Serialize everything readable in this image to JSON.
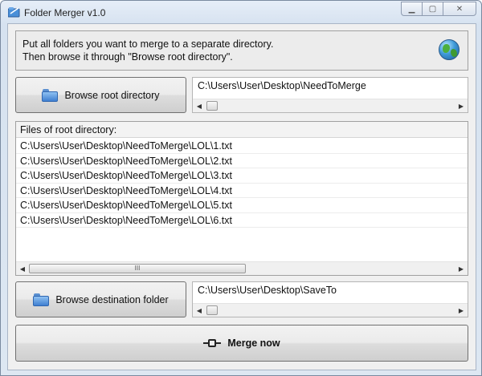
{
  "window": {
    "title": "Folder Merger v1.0",
    "controls": {
      "minimize": "▁",
      "maximize": "▢",
      "close": "✕"
    }
  },
  "info": {
    "line1": "Put all folders you want to merge to a separate directory.",
    "line2": "Then browse it through \"Browse root directory\".",
    "icon": "globe-icon"
  },
  "root": {
    "button_label": "Browse root directory",
    "path": "C:\\Users\\User\\Desktop\\NeedToMerge",
    "icon": "folder-icon"
  },
  "files": {
    "header": "Files of root directory:",
    "items": [
      "C:\\Users\\User\\Desktop\\NeedToMerge\\LOL\\1.txt",
      "C:\\Users\\User\\Desktop\\NeedToMerge\\LOL\\2.txt",
      "C:\\Users\\User\\Desktop\\NeedToMerge\\LOL\\3.txt",
      "C:\\Users\\User\\Desktop\\NeedToMerge\\LOL\\4.txt",
      "C:\\Users\\User\\Desktop\\NeedToMerge\\LOL\\5.txt",
      "C:\\Users\\User\\Desktop\\NeedToMerge\\LOL\\6.txt"
    ],
    "scroll_grip": "III"
  },
  "destination": {
    "button_label": "Browse destination folder",
    "path": "C:\\Users\\User\\Desktop\\SaveTo",
    "icon": "folder-icon"
  },
  "merge": {
    "button_label": "Merge now",
    "icon": "plug-icon"
  },
  "scroll_arrows": {
    "left": "◀",
    "right": "▶"
  },
  "colors": {
    "window_frame": "#dde7f2",
    "client_bg": "#f0f0f0",
    "folder_blue": "#3f7fd0"
  }
}
